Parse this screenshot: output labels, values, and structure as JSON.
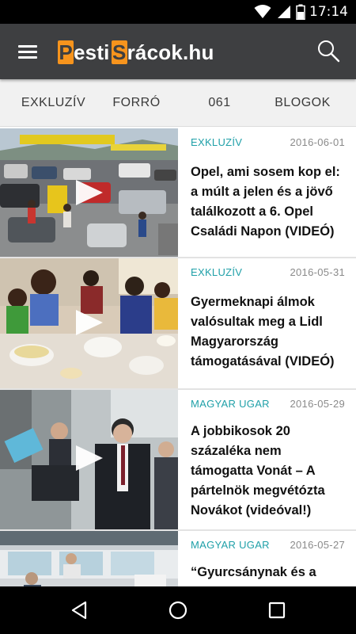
{
  "status_bar": {
    "time": "17:14",
    "icons": [
      "wifi-icon",
      "signal-icon",
      "battery-icon"
    ]
  },
  "app_bar": {
    "logo_boxed_1": "P",
    "logo_text_1": "esti",
    "logo_boxed_2": "S",
    "logo_text_2": "rácok.hu",
    "menu_icon": "hamburger-menu-icon",
    "search_icon": "search-icon"
  },
  "tabs": [
    "EXKLUZÍV",
    "FORRÓ",
    "061",
    "BLOGOK"
  ],
  "articles": [
    {
      "category": "EXKLUZÍV",
      "date": "2016-06-01",
      "title": "Opel, ami sosem kop el: a múlt a jelen és a jövő találkozott a 6. Opel Családi Napon (VIDEÓ)",
      "has_video": true
    },
    {
      "category": "EXKLUZÍV",
      "date": "2016-05-31",
      "title": "Gyermeknapi álmok valósultak meg a Lidl Magyarország támogatásával (VIDEÓ)",
      "has_video": true
    },
    {
      "category": "MAGYAR UGAR",
      "date": "2016-05-29",
      "title": "A jobbikosok 20 százaléka nem támogatta Vonát – A pártelnök megvétózta Novákot (videóval!)",
      "has_video": true
    },
    {
      "category": "MAGYAR UGAR",
      "date": "2016-05-27",
      "title": "“Gyurcsánynak és a",
      "has_video": false
    }
  ],
  "colors": {
    "app_bar": "#3e3f41",
    "logo_accent": "#f7941d",
    "category": "#1fa0a8",
    "tab_bg": "#f1f1f1"
  },
  "nav_bar": {
    "icons": [
      "back-icon",
      "home-icon",
      "recents-icon"
    ]
  }
}
